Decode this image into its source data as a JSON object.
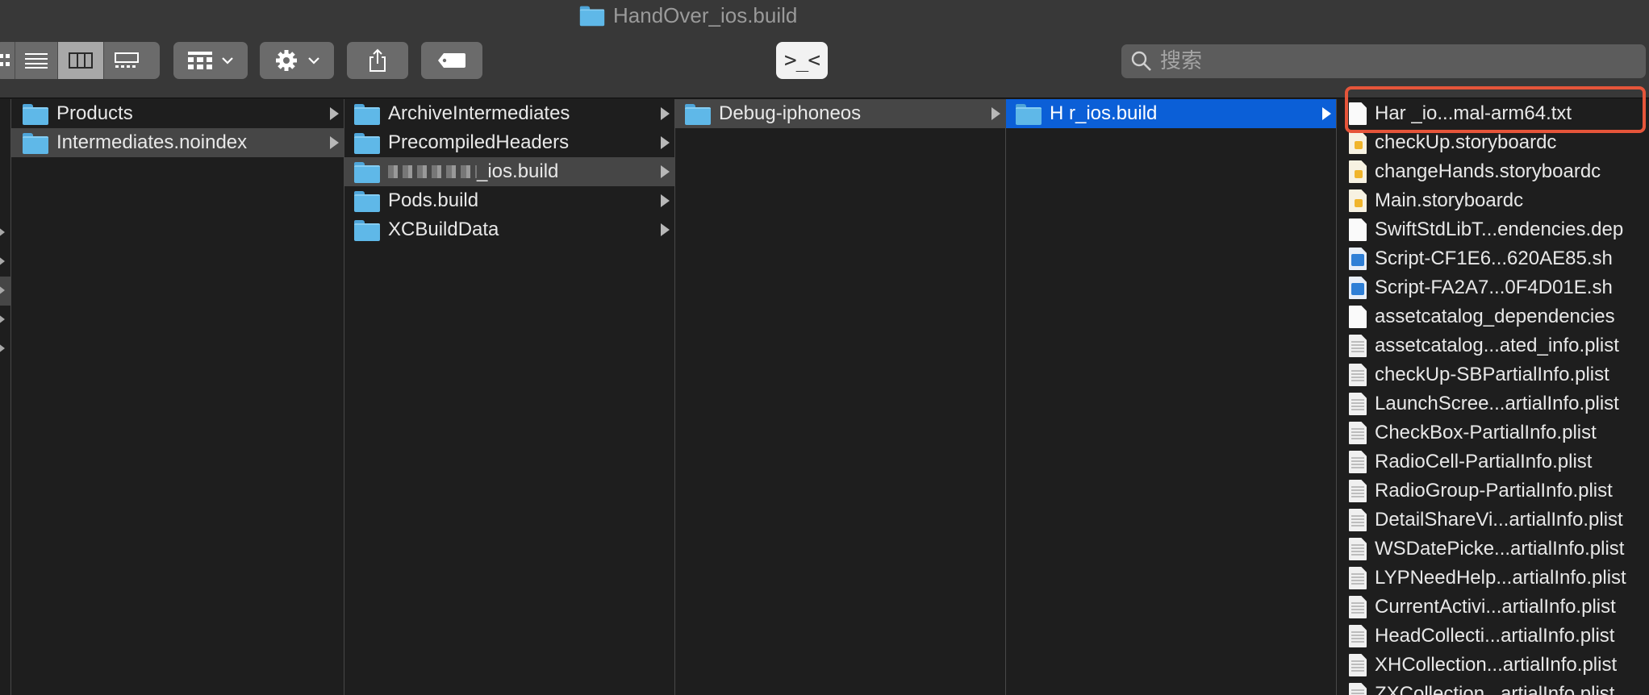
{
  "window": {
    "title": "HandOver_ios.build"
  },
  "toolbar": {
    "view_modes": [
      "icon-view",
      "list-view",
      "column-view",
      "gallery-view"
    ],
    "selected_view": "column-view",
    "terminal_label": ">_<",
    "search_placeholder": "搜索"
  },
  "columns": [
    {
      "items": [
        {
          "label": "Products",
          "kind": "folder",
          "has_children": true,
          "selected": false
        },
        {
          "label": "Intermediates.noindex",
          "kind": "folder",
          "has_children": true,
          "selected": true
        }
      ]
    },
    {
      "items": [
        {
          "label": "ArchiveIntermediates",
          "kind": "folder",
          "has_children": true,
          "selected": false
        },
        {
          "label": "PrecompiledHeaders",
          "kind": "folder",
          "has_children": true,
          "selected": false
        },
        {
          "label": "_ios.build",
          "kind": "folder",
          "has_children": true,
          "selected": true
        },
        {
          "label": "Pods.build",
          "kind": "folder",
          "has_children": true,
          "selected": false
        },
        {
          "label": "XCBuildData",
          "kind": "folder",
          "has_children": true,
          "selected": false
        }
      ]
    },
    {
      "items": [
        {
          "label": "Debug-iphoneos",
          "kind": "folder",
          "has_children": true,
          "selected": true
        }
      ]
    },
    {
      "items": [
        {
          "label": "H      r_ios.build",
          "kind": "folder",
          "has_children": true,
          "selected": true,
          "active": true
        }
      ]
    },
    {
      "items": [
        {
          "label": "Har    _io...mal-arm64.txt",
          "kind": "txt"
        },
        {
          "label": "checkUp.storyboardc",
          "kind": "storyboard"
        },
        {
          "label": "changeHands.storyboardc",
          "kind": "storyboard"
        },
        {
          "label": "Main.storyboardc",
          "kind": "storyboard"
        },
        {
          "label": "SwiftStdLibT...endencies.dep",
          "kind": "txt"
        },
        {
          "label": "Script-CF1E6...620AE85.sh",
          "kind": "shell"
        },
        {
          "label": "Script-FA2A7...0F4D01E.sh",
          "kind": "shell"
        },
        {
          "label": "assetcatalog_dependencies",
          "kind": "txt"
        },
        {
          "label": "assetcatalog...ated_info.plist",
          "kind": "plist"
        },
        {
          "label": "checkUp-SBPartialInfo.plist",
          "kind": "plist"
        },
        {
          "label": "LaunchScree...artialInfo.plist",
          "kind": "plist"
        },
        {
          "label": "CheckBox-PartialInfo.plist",
          "kind": "plist"
        },
        {
          "label": "RadioCell-PartialInfo.plist",
          "kind": "plist"
        },
        {
          "label": "RadioGroup-PartialInfo.plist",
          "kind": "plist"
        },
        {
          "label": "DetailShareVi...artialInfo.plist",
          "kind": "plist"
        },
        {
          "label": "WSDatePicke...artialInfo.plist",
          "kind": "plist"
        },
        {
          "label": "LYPNeedHelp...artialInfo.plist",
          "kind": "plist"
        },
        {
          "label": "CurrentActivi...artialInfo.plist",
          "kind": "plist"
        },
        {
          "label": "HeadCollecti...artialInfo.plist",
          "kind": "plist"
        },
        {
          "label": "XHCollection...artialInfo.plist",
          "kind": "plist"
        },
        {
          "label": "ZXCollection...artialInfo.plist",
          "kind": "plist"
        }
      ]
    }
  ],
  "colors": {
    "toolbar_bg": "#383838",
    "content_bg": "#1e1e1e",
    "selection_blue": "#0b5fd7",
    "selection_gray": "#464646",
    "folder_blue": "#5fb8e8",
    "highlight_red": "#e6553a"
  }
}
